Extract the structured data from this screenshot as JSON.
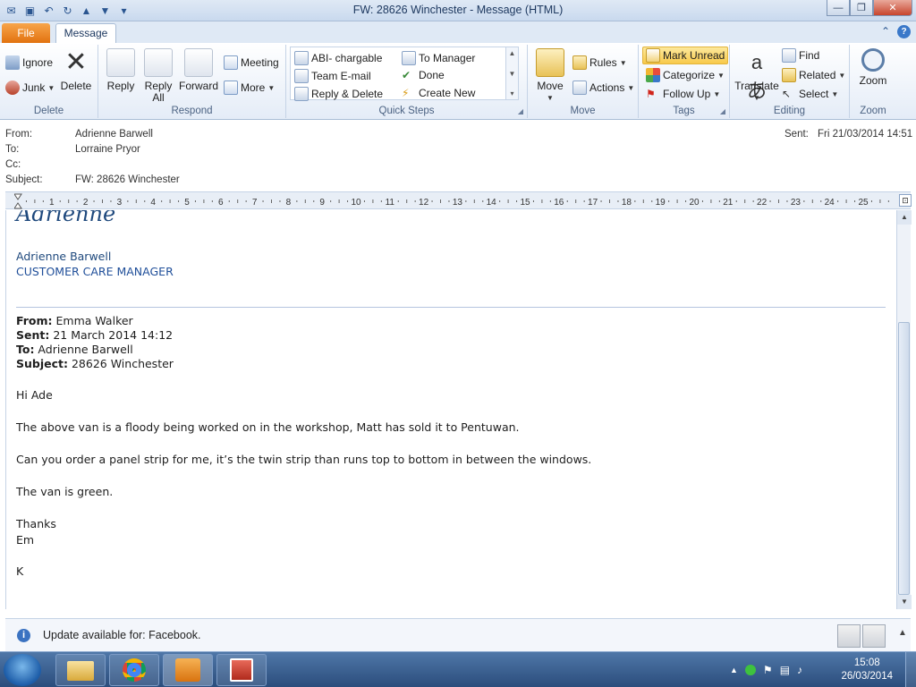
{
  "window": {
    "title": "FW: 28626 Winchester  -  Message (HTML)",
    "blurred_behind": "",
    "min_label": "—",
    "max_label": "❐",
    "close_label": "✕"
  },
  "tabs": {
    "file": "File",
    "message": "Message"
  },
  "ribbon": {
    "delete_group": {
      "ignore": "Ignore",
      "junk": "Junk",
      "delete": "Delete",
      "label": "Delete"
    },
    "respond_group": {
      "reply": "Reply",
      "reply_all_1": "Reply",
      "reply_all_2": "All",
      "forward": "Forward",
      "meeting": "Meeting",
      "more": "More",
      "label": "Respond"
    },
    "quick_steps": {
      "items": [
        "ABI- chargable",
        "Team E-mail",
        "Reply & Delete",
        "To Manager",
        "Done",
        "Create New"
      ],
      "label": "Quick Steps"
    },
    "move_group": {
      "move": "Move",
      "rules": "Rules",
      "actions": "Actions",
      "label": "Move"
    },
    "tags_group": {
      "mark_unread": "Mark Unread",
      "categorize": "Categorize",
      "follow_up": "Follow Up",
      "label": "Tags"
    },
    "editing_group": {
      "translate": "Translate",
      "find": "Find",
      "related": "Related",
      "select": "Select",
      "label": "Editing"
    },
    "zoom_group": {
      "zoom": "Zoom",
      "label": "Zoom"
    }
  },
  "header": {
    "from_label": "From:",
    "from": "Adrienne Barwell",
    "to_label": "To:",
    "to": "Lorraine Pryor",
    "cc_label": "Cc:",
    "subject_label": "Subject:",
    "subject": "FW: 28626 Winchester",
    "sent_label": "Sent:",
    "sent": "Fri 21/03/2014 14:51"
  },
  "ruler": {
    "numbers": [
      "1",
      "2",
      "3",
      "4",
      "5",
      "6",
      "7",
      "8",
      "9",
      "10",
      "11",
      "12",
      "13",
      "14",
      "15",
      "16",
      "17",
      "18",
      "19",
      "20",
      "21",
      "22",
      "23",
      "24",
      "25"
    ]
  },
  "body": {
    "signature_script": "Adrienne",
    "sig_name": "Adrienne Barwell",
    "sig_title": "CUSTOMER CARE MANAGER",
    "fw_from_label": "From:",
    "fw_from": " Emma Walker",
    "fw_sent_label": "Sent:",
    "fw_sent": " 21 March 2014 14:12",
    "fw_to_label": "To:",
    "fw_to": " Adrienne Barwell",
    "fw_subject_label": "Subject:",
    "fw_subject": " 28626 Winchester",
    "greeting": "Hi Ade",
    "p1": "The above van is a floody being worked on in the workshop, Matt has sold it to Pentuwan.",
    "p2": "Can you order a panel strip for me, it’s the twin strip than runs top to bottom in between the windows.",
    "p3": "The van is green.",
    "thanks": "Thanks",
    "em": "Em",
    "k": "K"
  },
  "update_bar": {
    "text": "Update available for: Facebook."
  },
  "taskbar": {
    "time": "15:08",
    "date": "26/03/2014"
  },
  "colors": {
    "accent": "#e2720f",
    "link_blue": "#1f497d",
    "ribbon_bg": "#e4ecf7"
  }
}
